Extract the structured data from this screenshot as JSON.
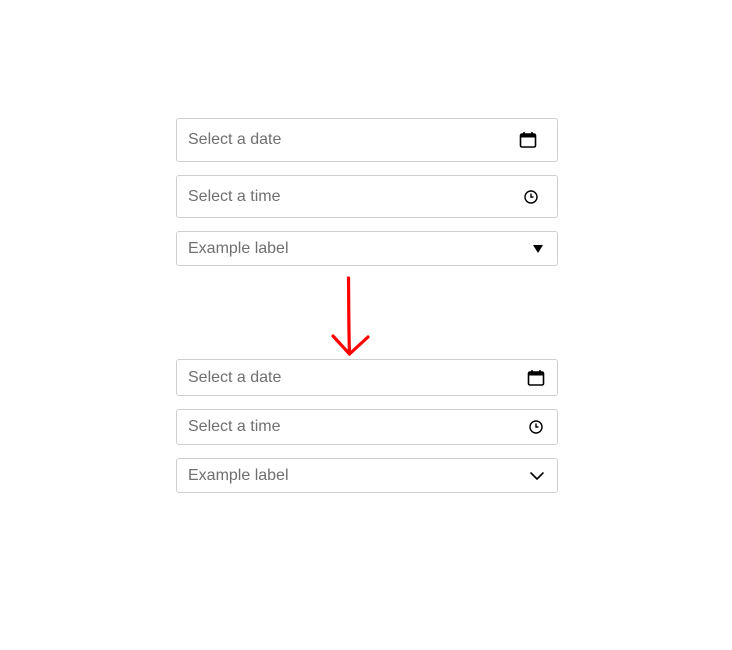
{
  "before": {
    "date_placeholder": "Select a date",
    "time_placeholder": "Select a time",
    "select_label": "Example label",
    "icons": [
      "calendar-icon",
      "clock-icon",
      "triangle-down-icon"
    ]
  },
  "after": {
    "date_placeholder": "Select a date",
    "time_placeholder": "Select a time",
    "select_label": "Example label",
    "icons": [
      "calendar-icon",
      "clock-icon",
      "chevron-down-icon"
    ]
  },
  "colors": {
    "border": "#cfcfcf",
    "placeholder": "#6f6f6f",
    "arrow": "#ff0000",
    "icon": "#000000"
  }
}
